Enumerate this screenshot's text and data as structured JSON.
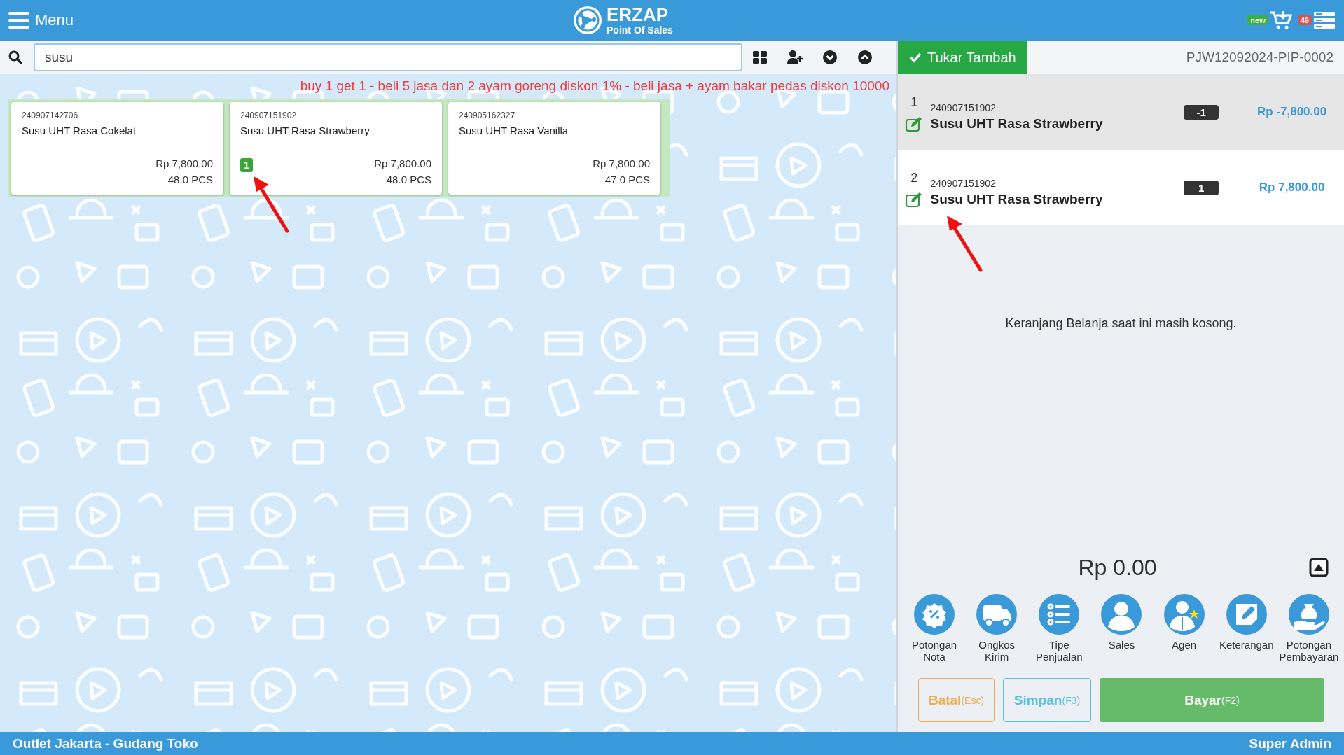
{
  "header": {
    "menu_label": "Menu",
    "brand": "ERZAP",
    "tagline": "Point Of Sales",
    "cart_badge": "new",
    "queue_badge": "49"
  },
  "search": {
    "value": "susu"
  },
  "promo": "buy 1 get 1 - beli 5 jasa dan 2 ayam goreng diskon 1% - beli jasa + ayam bakar pedas diskon 10000",
  "products": [
    {
      "code": "240907142706",
      "name": "Susu UHT Rasa Cokelat",
      "price": "Rp 7,800.00",
      "stock": "48.0 PCS",
      "annotated": false
    },
    {
      "code": "240907151902",
      "name": "Susu UHT Rasa Strawberry",
      "price": "Rp 7,800.00",
      "stock": "48.0 PCS",
      "in_cart": "1",
      "annotated": true
    },
    {
      "code": "240905162327",
      "name": "Susu UHT Rasa Vanilla",
      "price": "Rp 7,800.00",
      "stock": "47.0 PCS",
      "annotated": false
    }
  ],
  "cart": {
    "action": "Tukar Tambah",
    "invoice": "PJW12092024-PIP-0002",
    "items": [
      {
        "number": "1",
        "code": "240907151902",
        "name": "Susu UHT Rasa Strawberry",
        "qty": "-1",
        "amount": "Rp -7,800.00",
        "selected": true,
        "annotated": false
      },
      {
        "number": "2",
        "code": "240907151902",
        "name": "Susu UHT Rasa Strawberry",
        "qty": "1",
        "amount": "Rp 7,800.00",
        "selected": false,
        "annotated": true
      }
    ],
    "empty_message": "Keranjang Belanja saat ini masih kosong.",
    "total": "Rp 0.00"
  },
  "actions": [
    {
      "kind": "discount",
      "label": "Potongan Nota"
    },
    {
      "kind": "shipping",
      "label": "Ongkos Kirim"
    },
    {
      "kind": "type",
      "label": "Tipe Penjualan"
    },
    {
      "kind": "sales",
      "label": "Sales"
    },
    {
      "kind": "agent",
      "label": "Agen"
    },
    {
      "kind": "note",
      "label": "Keterangan"
    },
    {
      "kind": "payment",
      "label": "Potongan Pembayaran"
    }
  ],
  "buttons": [
    {
      "kind": "cancel",
      "label": "Batal",
      "key": "(Esc)"
    },
    {
      "kind": "save",
      "label": "Simpan",
      "key": "(F3)"
    },
    {
      "kind": "pay",
      "label": "Bayar",
      "key": "(F2)"
    }
  ],
  "status_bar": {
    "outlet": "Outlet Jakarta - Gudang Toko",
    "user": "Super Admin"
  }
}
